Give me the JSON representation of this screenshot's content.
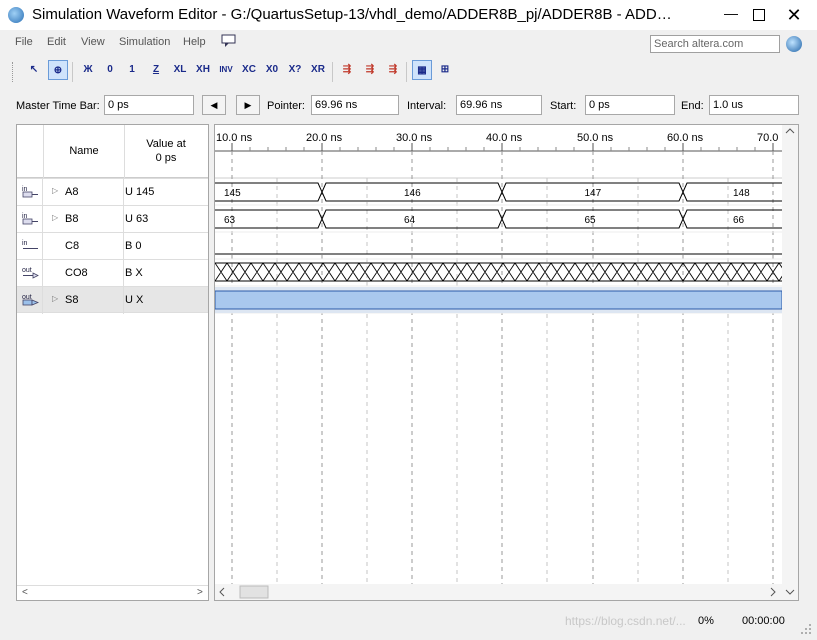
{
  "window": {
    "title": "Simulation Waveform Editor - G:/QuartusSetup-13/vhdl_demo/ADDER8B_pj/ADDER8B - ADD…",
    "min_glyph": "—",
    "close_glyph": "✕"
  },
  "menu": [
    "File",
    "Edit",
    "View",
    "Simulation",
    "Help"
  ],
  "search": {
    "placeholder": "Search altera.com"
  },
  "toolbar_glyphs": [
    "↖",
    "⊕",
    "Ж",
    "0",
    "1",
    "Z",
    "XL",
    "XH",
    "INV",
    "XC",
    "X0",
    "X?",
    "XR",
    "⇶",
    "⇶",
    "⇶",
    "▦",
    "⊞"
  ],
  "controls": {
    "master_time_bar_label": "Master Time Bar:",
    "master_time_bar_value": "0 ps",
    "prev_glyph": "◀",
    "next_glyph": "▶",
    "pointer_label": "Pointer:",
    "pointer_value": "69.96 ns",
    "interval_label": "Interval:",
    "interval_value": "69.96 ns",
    "start_label": "Start:",
    "start_value": "0 ps",
    "end_label": "End:",
    "end_value": "1.0 us"
  },
  "signal_table": {
    "name_header": "Name",
    "value_header_line1": "Value at",
    "value_header_line2": "0 ps",
    "signals": [
      {
        "pin": "in",
        "expandable": true,
        "name": "A8",
        "value": "U 145"
      },
      {
        "pin": "in",
        "expandable": true,
        "name": "B8",
        "value": "U 63"
      },
      {
        "pin": "in",
        "expandable": false,
        "name": "C8",
        "value": "B 0"
      },
      {
        "pin": "out",
        "expandable": false,
        "name": "CO8",
        "value": "B X"
      },
      {
        "pin": "out",
        "expandable": true,
        "name": "S8",
        "value": "U X"
      }
    ]
  },
  "timeline": {
    "ticks": [
      "10.0 ns",
      "20.0 ns",
      "30.0 ns",
      "40.0 ns",
      "50.0 ns",
      "60.0 ns",
      "70.0"
    ]
  },
  "waveforms": {
    "A8": [
      "145",
      "146",
      "147",
      "148"
    ],
    "B8": [
      "63",
      "64",
      "65",
      "66"
    ]
  },
  "status": {
    "percent": "0%",
    "time": "00:00:00",
    "watermark": "https://blog.csdn.net/..."
  },
  "colors": {
    "selected_row": "#a9c8ee",
    "s8_wave": "#a9c8ee",
    "grid_dash": "#9a9a9a"
  }
}
